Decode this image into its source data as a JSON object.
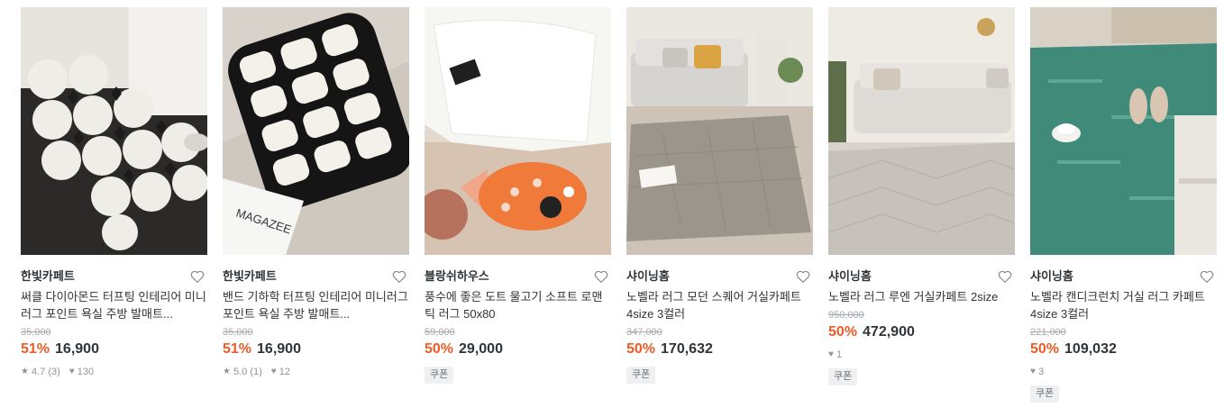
{
  "colors": {
    "discount": "#f05a28",
    "text": "#2f3438",
    "muted": "#a5aaae"
  },
  "products": [
    {
      "brand": "한빛카페트",
      "title": "써클 다이아몬드 터프팅 인테리어 미니러그 포인트 욕실 주방 발매트...",
      "original_price": "35,000",
      "discount": "51%",
      "price": "16,900",
      "rating": "4.7 (3)",
      "likes": "130",
      "coupon": "",
      "image": "circle-diamond-rug",
      "heart_icon": "heart-outline-icon"
    },
    {
      "brand": "한빛카페트",
      "title": "밴드 기하학 터프팅 인테리어 미니러그 포인트 욕실 주방 발매트...",
      "original_price": "35,000",
      "discount": "51%",
      "price": "16,900",
      "rating": "5.0 (1)",
      "likes": "12",
      "coupon": "",
      "image": "band-geometric-rug",
      "magazine_text": "MAGAZEE",
      "heart_icon": "heart-outline-icon"
    },
    {
      "brand": "블랑쉬하우스",
      "title": "풍수에 좋은 도트 물고기 소프트 로맨틱 러그 50x80",
      "original_price": "59,000",
      "discount": "50%",
      "price": "29,000",
      "rating": "",
      "likes": "",
      "coupon": "쿠폰",
      "image": "fish-rug",
      "heart_icon": "heart-outline-icon"
    },
    {
      "brand": "샤이닝홈",
      "title": "노벨라 러그 모던 스퀘어 거실카페트 4size 3컬러",
      "original_price": "347,000",
      "discount": "50%",
      "price": "170,632",
      "rating": "",
      "likes": "",
      "coupon": "쿠폰",
      "image": "square-living-rug",
      "heart_icon": "heart-outline-icon"
    },
    {
      "brand": "샤이닝홈",
      "title": "노벨라 러그 루엔 거실카페트 2size",
      "original_price": "950,000",
      "discount": "50%",
      "price": "472,900",
      "rating": "",
      "likes": "1",
      "coupon": "쿠폰",
      "image": "ruen-living-rug",
      "heart_icon": "heart-outline-icon"
    },
    {
      "brand": "샤이닝홈",
      "title": "노벨라 캔디크런치 거실 러그 카페트 4size 3컬러",
      "original_price": "221,000",
      "discount": "50%",
      "price": "109,032",
      "rating": "",
      "likes": "3",
      "coupon": "쿠폰",
      "image": "candy-crunch-rug",
      "heart_icon": "heart-outline-icon"
    }
  ]
}
